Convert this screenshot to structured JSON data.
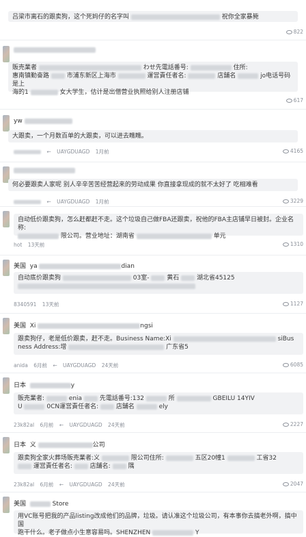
{
  "posts": [
    {
      "text": "吕梁市离石的跟卖狗，这个死妈仔的名字叫",
      "text_tail": "祝你全家暴毙",
      "views": "822"
    },
    {
      "lines": [
        "販売業者",
        "店舗名",
        "惠南镇勤奋路",
        "市浦东新区上海市",
        "運営責任者名:",
        "jo电话号码是上",
        "海的1",
        "女大学生，估计是出借营业执照给别人注册店铺"
      ],
      "extra": "わせ先電話番号:",
      "extra2": "住所:",
      "views": "617"
    },
    {
      "store": "yw",
      "text": "大跟卖，一个月数百单的大跟卖，可以进去瞧瞧。",
      "author": "UAYGDUAGD",
      "time": "1月前",
      "views": "4165"
    },
    {
      "text": "何必要跟卖人家呢 别人辛辛苦苦经营起来的劳动成果 你直接拿现成的就不太好了 吃相难看",
      "author": "UAYGDUAGD",
      "time": "1月前",
      "views": "3229"
    },
    {
      "text1": "自动低价跟卖狗，怎么赶都赶不走。这个垃圾自己做FBA还跟卖，祝他的FBA主店铺早日被封。企业名称:",
      "text2": "限公司。营业地址：湖南省",
      "text2_tail": "单元",
      "author": "hot",
      "time": "13天前",
      "views": "1310"
    },
    {
      "country": "美国",
      "store": "ya",
      "store_tail": "dian",
      "text1": "自动底价跟卖狗",
      "text1_mid": "03室-",
      "text1_mid2": "黄石",
      "text1_tail": "湖北省45125",
      "author": "8340591",
      "time": "13天前",
      "views": "1127"
    },
    {
      "country": "美国",
      "store": "Xi",
      "store_tail": "ngsi",
      "text1": "跟卖狗仔，老是低价跟卖，赶不走。Business Name:Xi",
      "text1_tail": "siBus",
      "text2": "ness Address:增",
      "text2_tail": "广东省5",
      "author": "anida",
      "time": "6月前",
      "author2": "UAYGDUAGD",
      "time2": "24天前",
      "views": "6085"
    },
    {
      "country": "日本",
      "store_tail": "y",
      "text1": "販売業者:",
      "text1_mid": "enia",
      "text1_mid2": "先電話番号:132",
      "text1_mid3": "所",
      "text1_tail": "GBEILU 14YIV",
      "text2": "U",
      "text2_mid": "0CN運営責任者名:",
      "text2_mid2": "店舗名",
      "text2_tail": "ely",
      "author": "23k82al",
      "time": "6月前",
      "author2": "UAYGDUAGD",
      "time2": "24天前",
      "views": "2227"
    },
    {
      "country": "日本",
      "store": "义",
      "store_tail": "公司",
      "text1": "跟卖狗全家火葬场販売業者:义",
      "text1_mid": "限公司住所:",
      "text1_mid2": "五区20幢1",
      "text1_tail": "工省32",
      "text2": "運営責任者名:",
      "text2_mid": "店舗名:",
      "text2_tail": "隅",
      "author": "23k82al",
      "time": "6月前",
      "author2": "UAYGDUAGD",
      "time2": "24天前",
      "views": "2047"
    },
    {
      "country": "美国",
      "store": "Store",
      "text1": "用VC账号把我的产品listing改成他们的品牌，垃圾。请认准这个垃圾公司，有本事你去搞老外啊，搞中国",
      "text2": "跑干什么。老子做点小生意容易吗。SHENZHEN",
      "text2_tail": "Y"
    }
  ],
  "reply_arrow": "←"
}
